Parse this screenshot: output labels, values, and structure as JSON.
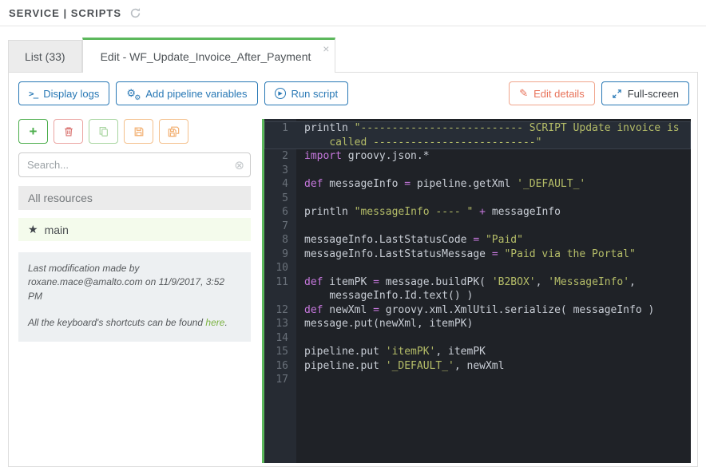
{
  "breadcrumb": {
    "text": "SERVICE | SCRIPTS"
  },
  "tabs": {
    "list": {
      "label": "List (33)"
    },
    "edit": {
      "label": "Edit - WF_Update_Invoice_After_Payment",
      "close": "×"
    }
  },
  "toolbar": {
    "display_logs": "Display logs",
    "add_pipeline_variables": "Add pipeline variables",
    "run_script": "Run script",
    "edit_details": "Edit details",
    "full_screen": "Full-screen"
  },
  "icons": {
    "terminal": ">_",
    "gear_large": "⚙",
    "gear_small": "⚙",
    "play": "▶",
    "pencil": "✎",
    "plus": "+",
    "star": "★",
    "clear_circle": "⊗"
  },
  "sidebar": {
    "search_placeholder": "Search...",
    "list_header": "All resources",
    "items": [
      {
        "label": "main"
      }
    ],
    "note": {
      "line1": "Last modification made by roxane.mace@amalto.com on 11/9/2017, 3:52 PM",
      "line2_prefix": "All the keyboard's shortcuts can be found ",
      "link": "here",
      "suffix": "."
    }
  },
  "colors": {
    "accent_blue": "#2878b5",
    "accent_green": "#5cb85c",
    "accent_orange": "#e8735a",
    "editor_bg": "#1f2227",
    "gutter_bg": "#262b33",
    "string": "#b5bd68",
    "keyword": "#c678dd"
  },
  "editor": {
    "lines": [
      {
        "n": "1",
        "active": true,
        "seg": [
          [
            "p",
            "println "
          ],
          [
            "s",
            "\"-------------------------- SCRIPT Update invoice is\n    called --------------------------\""
          ]
        ]
      },
      {
        "n": "2",
        "seg": [
          [
            "k",
            "import"
          ],
          [
            "p",
            " groovy.json.*"
          ]
        ]
      },
      {
        "n": "3",
        "seg": []
      },
      {
        "n": "4",
        "seg": [
          [
            "k",
            "def"
          ],
          [
            "p",
            " messageInfo "
          ],
          [
            "o",
            "="
          ],
          [
            "p",
            " pipeline.getXml "
          ],
          [
            "s",
            "'_DEFAULT_'"
          ]
        ]
      },
      {
        "n": "5",
        "seg": []
      },
      {
        "n": "6",
        "seg": [
          [
            "p",
            "println "
          ],
          [
            "s",
            "\"messageInfo ---- \""
          ],
          [
            "p",
            " "
          ],
          [
            "o",
            "+"
          ],
          [
            "p",
            " messageInfo"
          ]
        ]
      },
      {
        "n": "7",
        "seg": []
      },
      {
        "n": "8",
        "seg": [
          [
            "p",
            "messageInfo.LastStatusCode "
          ],
          [
            "o",
            "="
          ],
          [
            "p",
            " "
          ],
          [
            "s",
            "\"Paid\""
          ]
        ]
      },
      {
        "n": "9",
        "seg": [
          [
            "p",
            "messageInfo.LastStatusMessage "
          ],
          [
            "o",
            "="
          ],
          [
            "p",
            " "
          ],
          [
            "s",
            "\"Paid via the Portal\""
          ]
        ]
      },
      {
        "n": "10",
        "seg": []
      },
      {
        "n": "11",
        "seg": [
          [
            "k",
            "def"
          ],
          [
            "p",
            " itemPK "
          ],
          [
            "o",
            "="
          ],
          [
            "p",
            " message.buildPK( "
          ],
          [
            "s",
            "'B2BOX'"
          ],
          [
            "p",
            ", "
          ],
          [
            "s",
            "'MessageInfo'"
          ],
          [
            "p",
            ",\n    messageInfo.Id.text() )"
          ]
        ]
      },
      {
        "n": "12",
        "seg": [
          [
            "k",
            "def"
          ],
          [
            "p",
            " newXml "
          ],
          [
            "o",
            "="
          ],
          [
            "p",
            " groovy.xml.XmlUtil.serialize( messageInfo )"
          ]
        ]
      },
      {
        "n": "13",
        "seg": [
          [
            "p",
            "message.put(newXml, itemPK)"
          ]
        ]
      },
      {
        "n": "14",
        "seg": []
      },
      {
        "n": "15",
        "seg": [
          [
            "p",
            "pipeline.put "
          ],
          [
            "s",
            "'itemPK'"
          ],
          [
            "p",
            ", itemPK"
          ]
        ]
      },
      {
        "n": "16",
        "seg": [
          [
            "p",
            "pipeline.put "
          ],
          [
            "s",
            "'_DEFAULT_'"
          ],
          [
            "p",
            ", newXml"
          ]
        ]
      },
      {
        "n": "17",
        "seg": []
      }
    ]
  }
}
